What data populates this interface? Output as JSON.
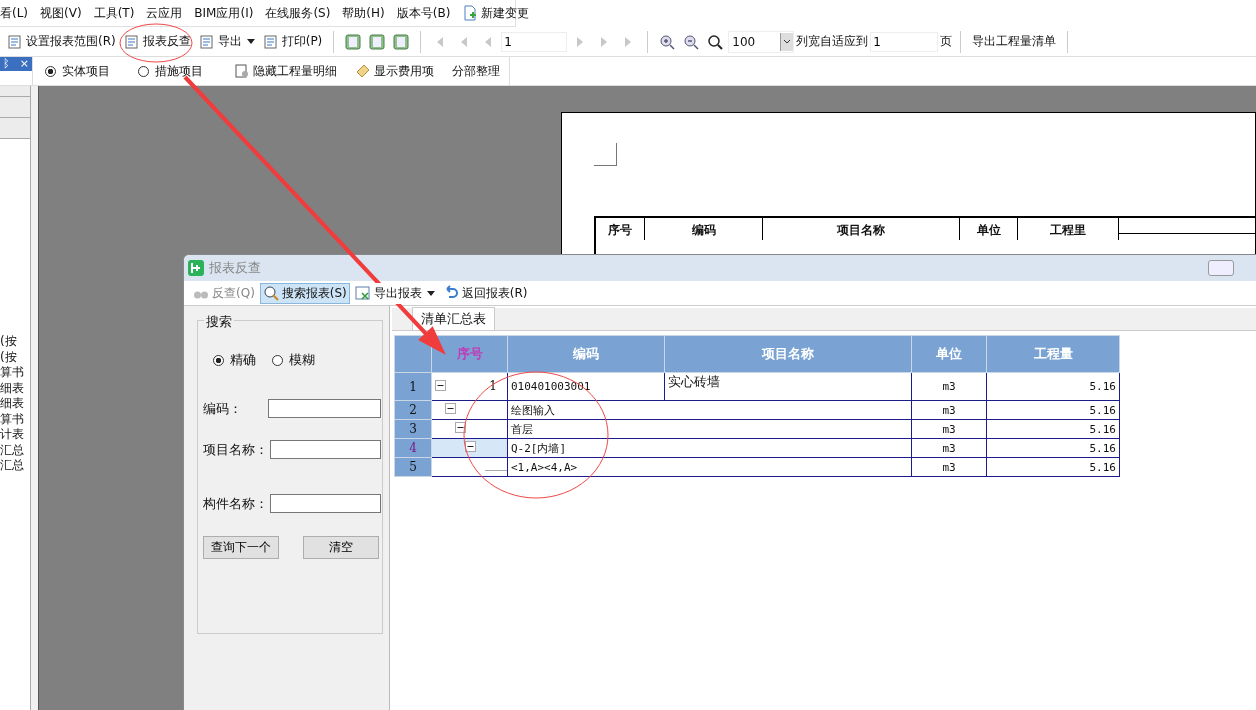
{
  "menu_bar": [
    "看(L)",
    "视图(V)",
    "工具(T)",
    "云应用",
    "BIM应用(I)",
    "在线服务(S)",
    "帮助(H)",
    "版本号(B)",
    "新建变更"
  ],
  "toolbar": {
    "buttons": [
      {
        "label": "设置报表范围(R)",
        "kind": "button"
      },
      {
        "label": "报表反查",
        "kind": "button"
      },
      {
        "label": "导出",
        "kind": "dropdown"
      },
      {
        "label": "打印(P)",
        "kind": "button"
      }
    ],
    "page_field": "1",
    "nav_disabled": true,
    "zoom_field": "100",
    "fit_label": "列宽自适应到",
    "fit_field": "1",
    "fit_unit": "页",
    "export_list": "导出工程量清单"
  },
  "filter_bar": {
    "pin": "ᛒ",
    "close": "×",
    "options": [
      {
        "label": "实体项目",
        "selected": true
      },
      {
        "label": "措施项目",
        "selected": false
      }
    ],
    "actions": [
      "隐藏工程量明细",
      "显示费用项",
      "分部整理"
    ]
  },
  "side_list": [
    "(按",
    "(按",
    "算书",
    "细表",
    "细表",
    "算书",
    "计表",
    "汇总",
    "汇总"
  ],
  "report_page": {
    "headers": [
      "序号",
      "编码",
      "项目名称",
      "单位",
      "工程里"
    ]
  },
  "dialog": {
    "title": "报表反查",
    "toolbar": [
      {
        "label": "反查(Q)",
        "kind": "button",
        "disabled": true,
        "selected": false
      },
      {
        "label": "搜索报表(S)",
        "kind": "button",
        "disabled": false,
        "selected": true
      },
      {
        "label": "导出报表",
        "kind": "dropdown",
        "disabled": false,
        "selected": false
      },
      {
        "label": "返回报表(R)",
        "kind": "button",
        "disabled": false,
        "selected": false
      }
    ],
    "search": {
      "title": "搜索",
      "modes": [
        {
          "label": "精确",
          "selected": true
        },
        {
          "label": "模糊",
          "selected": false
        }
      ],
      "fields": [
        {
          "label": "编码："
        },
        {
          "label": "项目名称："
        },
        {
          "label": "构件名称："
        }
      ],
      "buttons": [
        "查询下一个",
        "清空"
      ]
    },
    "tab": "清单汇总表",
    "table": {
      "columns": [
        "序号",
        "编码",
        "项目名称",
        "单位",
        "工程量"
      ],
      "rows": [
        {
          "row_number": "1",
          "seq": "1",
          "code": "010401003001",
          "name": "实心砖墙",
          "unit": "m3",
          "quantity": "5.16",
          "expanded": true,
          "selected": false,
          "children": [
            {
              "row_number": "2",
              "name": "绘图输入",
              "unit": "m3",
              "quantity": "5.16",
              "expanded": true,
              "selected": false,
              "children": [
                {
                  "row_number": "3",
                  "name": "首层",
                  "unit": "m3",
                  "quantity": "5.16",
                  "expanded": true,
                  "selected": false,
                  "children": [
                    {
                      "row_number": "4",
                      "name": "Q-2[内墙]",
                      "unit": "m3",
                      "quantity": "5.16",
                      "expanded": true,
                      "selected": true,
                      "children": [
                        {
                          "row_number": "5",
                          "name": "<1,A><4,A>",
                          "unit": "m3",
                          "quantity": "5.16",
                          "selected": false
                        }
                      ]
                    }
                  ]
                }
              ]
            }
          ]
        }
      ]
    }
  }
}
